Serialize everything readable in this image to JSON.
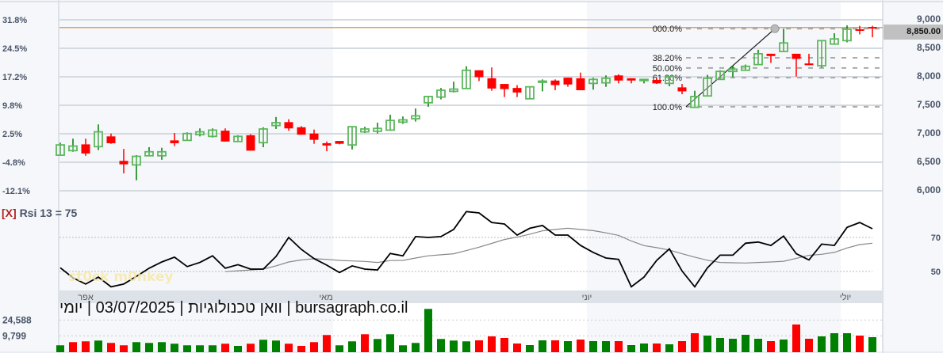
{
  "chart_data": [
    {
      "type": "candlestick",
      "title": "",
      "x_months": [
        {
          "label": "אפר",
          "first_bar": 0
        },
        {
          "label": "מאי",
          "first_bar": 22
        },
        {
          "label": "יוני",
          "first_bar": 42
        },
        {
          "label": "יולי",
          "first_bar": 62
        }
      ],
      "y_right_ticks": [
        "6,000",
        "6,500",
        "7,000",
        "7,500",
        "8,000",
        "8,500",
        "9,000"
      ],
      "y_right_values": [
        6000,
        6500,
        7000,
        7500,
        8000,
        8500,
        9000
      ],
      "y_left_ticks": [
        "-12.1%",
        "-4.8%",
        "2.5%",
        "9.8%",
        "17.2%",
        "24.5%",
        "31.8%"
      ],
      "ylim": [
        6000,
        9000
      ],
      "grid": true,
      "candles_ohlc": [
        [
          6610,
          6830,
          6610,
          6790
        ],
        [
          6690,
          6900,
          6670,
          6770
        ],
        [
          6800,
          6900,
          6600,
          6640
        ],
        [
          6760,
          7150,
          6700,
          7020
        ],
        [
          6940,
          6990,
          6810,
          6820
        ],
        [
          6510,
          6720,
          6290,
          6450
        ],
        [
          6440,
          6610,
          6170,
          6590
        ],
        [
          6600,
          6750,
          6590,
          6670
        ],
        [
          6600,
          6740,
          6530,
          6670
        ],
        [
          6870,
          7000,
          6770,
          6820
        ],
        [
          6870,
          7010,
          6870,
          6990
        ],
        [
          6970,
          7080,
          6940,
          7020
        ],
        [
          6940,
          7080,
          6920,
          7050
        ],
        [
          7040,
          7080,
          6850,
          6850
        ],
        [
          6850,
          6960,
          6850,
          6940
        ],
        [
          6960,
          6980,
          6690,
          6690
        ],
        [
          6830,
          7100,
          6750,
          7070
        ],
        [
          7130,
          7280,
          7070,
          7180
        ],
        [
          7190,
          7240,
          7040,
          7080
        ],
        [
          7100,
          7120,
          6970,
          6970
        ],
        [
          6990,
          7060,
          6810,
          6880
        ],
        [
          6820,
          6850,
          6680,
          6780
        ],
        [
          6860,
          6860,
          6800,
          6810
        ],
        [
          6790,
          7110,
          6710,
          7110
        ],
        [
          7020,
          7110,
          7000,
          7070
        ],
        [
          7030,
          7180,
          6990,
          7080
        ],
        [
          7050,
          7320,
          7050,
          7220
        ],
        [
          7190,
          7290,
          7160,
          7230
        ],
        [
          7250,
          7430,
          7200,
          7300
        ],
        [
          7530,
          7640,
          7460,
          7640
        ],
        [
          7630,
          7790,
          7590,
          7750
        ],
        [
          7730,
          7900,
          7710,
          7770
        ],
        [
          7780,
          8170,
          7780,
          8100
        ],
        [
          8100,
          8100,
          7910,
          7980
        ],
        [
          7960,
          8150,
          7740,
          7780
        ],
        [
          7860,
          7860,
          7630,
          7770
        ],
        [
          7790,
          7840,
          7630,
          7710
        ],
        [
          7600,
          7820,
          7600,
          7810
        ],
        [
          7890,
          7940,
          7730,
          7910
        ],
        [
          7920,
          7940,
          7750,
          7840
        ],
        [
          7970,
          7970,
          7810,
          7850
        ],
        [
          7960,
          8060,
          7750,
          7750
        ],
        [
          7870,
          7970,
          7760,
          7940
        ],
        [
          7880,
          8010,
          7810,
          7960
        ],
        [
          8010,
          8030,
          7870,
          7920
        ],
        [
          7960,
          7960,
          7870,
          7920
        ],
        [
          7920,
          7950,
          7870,
          7940
        ],
        [
          7930,
          7960,
          7860,
          7870
        ],
        [
          7870,
          8000,
          7820,
          7990
        ],
        [
          7800,
          7860,
          7680,
          7730
        ],
        [
          7450,
          7740,
          7450,
          7640
        ],
        [
          7650,
          8020,
          7650,
          7960
        ],
        [
          7940,
          8100,
          7940,
          8080
        ],
        [
          8080,
          8180,
          7980,
          8120
        ],
        [
          8100,
          8200,
          8100,
          8170
        ],
        [
          8200,
          8460,
          8200,
          8390
        ],
        [
          8390,
          8390,
          8230,
          8350
        ],
        [
          8430,
          8830,
          8430,
          8580
        ],
        [
          8390,
          8390,
          7990,
          8300
        ],
        [
          8220,
          8390,
          8190,
          8190
        ],
        [
          8180,
          8620,
          8150,
          8620
        ],
        [
          8560,
          8750,
          8560,
          8650
        ],
        [
          8620,
          8890,
          8590,
          8820
        ],
        [
          8820,
          8880,
          8730,
          8800
        ],
        [
          8860,
          8880,
          8680,
          8850
        ]
      ],
      "last_price": 8850,
      "last_price_label": "8,850.00",
      "fibonacci": {
        "from_bar": 50,
        "to_bar": 57,
        "low": 7460,
        "high": 8830,
        "levels": [
          {
            "label": "000.0%",
            "price": 8830
          },
          {
            "label": "38.20%",
            "price": 8320
          },
          {
            "label": "50.00%",
            "price": 8140
          },
          {
            "label": "61.80%",
            "price": 7970
          },
          {
            "label": "100.0%",
            "price": 7460
          }
        ]
      },
      "colors": {
        "up": "#5cb85c",
        "up_wick": "#007a00",
        "down": "#ff0000",
        "last_price_line": "#d9822b"
      }
    },
    {
      "type": "line",
      "indicator_label": "Rsi 13 = 75",
      "close_label": "[X]",
      "y_ticks": [
        "50",
        "70"
      ],
      "y_tick_values": [
        50,
        70
      ],
      "rsi": [
        52.2,
        46.3,
        42.6,
        46.7,
        41.0,
        42.6,
        47.1,
        51.9,
        55.6,
        58.4,
        52.9,
        55.3,
        59.2,
        51.9,
        54.0,
        51.4,
        51.4,
        58.8,
        70,
        63.0,
        57.6,
        53.7,
        49.4,
        53.3,
        51.4,
        50.9,
        60.6,
        59.2,
        70.5,
        70,
        70.5,
        74.7,
        85.2,
        84.4,
        78.8,
        77.9,
        71.4,
        75.4,
        77.0,
        71.4,
        71.4,
        65.3,
        61.2,
        57.9,
        57.1,
        41.0,
        46.7,
        56.5,
        63.3,
        50.3,
        41.0,
        52.2,
        59.6,
        59.6,
        66.6,
        67.3,
        65.3,
        70.8,
        60.4,
        56.8,
        66.1,
        65.3,
        75.9,
        78.8,
        75.1
      ],
      "rsi_ma": [
        null,
        null,
        null,
        null,
        null,
        null,
        null,
        null,
        null,
        null,
        null,
        null,
        null,
        49.9,
        50.4,
        50.9,
        51.4,
        53.3,
        55.6,
        56.8,
        57.5,
        57.1,
        56.5,
        56.2,
        55.9,
        55.3,
        56.4,
        56.5,
        57.9,
        59.2,
        59.8,
        60.4,
        62.3,
        64.3,
        66.5,
        68.8,
        70.2,
        71.9,
        73.9,
        74.7,
        75.4,
        74.7,
        74.0,
        72.7,
        71.2,
        67.9,
        65.2,
        64.0,
        62.6,
        60.4,
        58.4,
        56.6,
        55.3,
        55.1,
        55.0,
        55.3,
        55.6,
        56.0,
        57.7,
        59.5,
        60.1,
        61.2,
        63.8,
        65.8,
        66.6
      ],
      "colors": {
        "rsi": "#000000",
        "ma": "#888888"
      }
    },
    {
      "type": "bar",
      "y_ticks": [
        "9,799",
        "24,588"
      ],
      "y_tick_values": [
        9799,
        24588
      ],
      "volume": [
        940,
        3900,
        4640,
        5370,
        3160,
        940,
        3900,
        3160,
        3900,
        2420,
        940,
        940,
        940,
        2420,
        50,
        2420,
        6110,
        5370,
        2420,
        50,
        3900,
        10550,
        940,
        4640,
        11290,
        6850,
        11290,
        940,
        3160,
        34955,
        6850,
        5370,
        4640,
        5620,
        9320,
        7840,
        2660,
        1180,
        5620,
        5620,
        4880,
        6360,
        4880,
        4880,
        4880,
        1180,
        2660,
        2660,
        1920,
        4880,
        12280,
        10060,
        7840,
        7100,
        10800,
        7100,
        4880,
        6360,
        20410,
        7100,
        9320,
        12280,
        12280,
        10060,
        8580
      ],
      "direction": [
        "up",
        "down",
        "down",
        "up",
        "down",
        "down",
        "up",
        "up",
        "up",
        "up",
        "up",
        "up",
        "up",
        "down",
        "up",
        "down",
        "up",
        "up",
        "down",
        "down",
        "down",
        "down",
        "up",
        "up",
        "down",
        "up",
        "up",
        "up",
        "up",
        "up",
        "up",
        "up",
        "up",
        "down",
        "down",
        "down",
        "down",
        "up",
        "up",
        "down",
        "up",
        "down",
        "up",
        "up",
        "down",
        "up",
        "up",
        "down",
        "up",
        "down",
        "down",
        "up",
        "up",
        "up",
        "up",
        "up",
        "down",
        "up",
        "down",
        "down",
        "up",
        "up",
        "up",
        "down",
        "up"
      ],
      "colors": {
        "up": "#008000",
        "down": "#ff0000"
      }
    }
  ],
  "header": {
    "title_parts": [
      "יומי",
      "|",
      "03/07/2025",
      "|",
      "וואן טכנולוגיות",
      "|",
      "bursagraph.co.il"
    ]
  },
  "watermark": "st0ck m0nkey"
}
